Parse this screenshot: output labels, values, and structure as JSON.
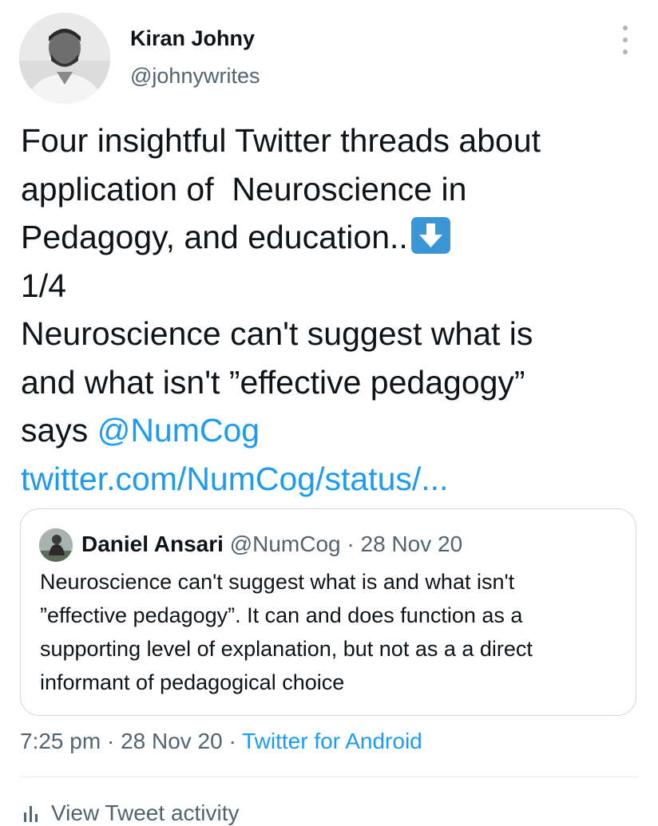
{
  "author": {
    "name": "Kiran Johny",
    "handle": "@johnywrites"
  },
  "tweet": {
    "lines": [
      "Four insightful Twitter threads about",
      "application of  Neuroscience in",
      "Pedagogy, and education..",
      "1/4",
      "Neuroscience can't suggest what is",
      "and what isn't ”effective pedagogy”",
      "says "
    ],
    "mention": "@NumCog",
    "link": "twitter.com/NumCog/status/..."
  },
  "quote": {
    "name": "Daniel Ansari",
    "handle": "@NumCog",
    "separator": " · ",
    "date": "28 Nov 20",
    "lines": [
      "Neuroscience can't suggest what is and what isn't",
      "”effective pedagogy”. It can and does function as a",
      "supporting level of explanation, but not as a a direct",
      "informant of pedagogical choice"
    ]
  },
  "meta": {
    "time": "7:25 pm",
    "separator": " · ",
    "date": "28 Nov 20",
    "source": "Twitter for Android"
  },
  "activity": {
    "label": "View Tweet activity"
  },
  "icons": {
    "more": "more-vertical-icon",
    "emoji": "down-arrow-emoji-icon",
    "activity": "bar-chart-icon"
  },
  "colors": {
    "link": "#1d9bf0",
    "secondary": "#536471",
    "text": "#0f1419"
  }
}
